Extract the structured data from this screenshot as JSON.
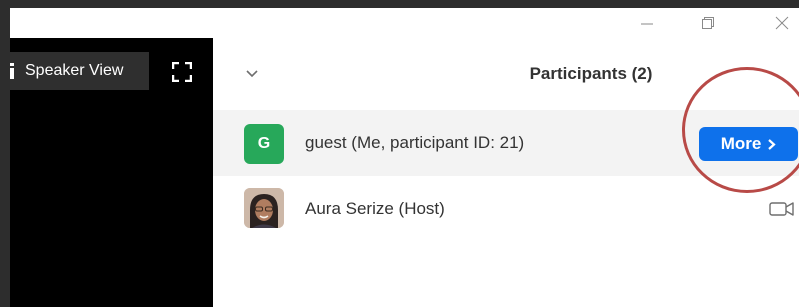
{
  "window_controls": {
    "minimize_icon": "minimize-icon",
    "restore_icon": "restore-icon",
    "close_icon": "close-icon"
  },
  "video": {
    "view_mode_label": "Speaker View",
    "fullscreen_icon": "fullscreen-icon"
  },
  "participants": {
    "title": "Participants (2)",
    "collapse_icon": "chevron-down-icon",
    "list": [
      {
        "avatar_letter": "G",
        "avatar_color": "#27a85a",
        "name": "guest (Me, participant ID: 21)",
        "action_label": "More",
        "action_icon": "chevron-right-icon"
      },
      {
        "avatar_type": "photo",
        "name": "Aura Serize (Host)",
        "status_icon": "video-camera-icon"
      }
    ]
  },
  "colors": {
    "more_button": "#0e71eb",
    "highlight_circle": "#b84a47",
    "frame": "#2d2d2d"
  }
}
